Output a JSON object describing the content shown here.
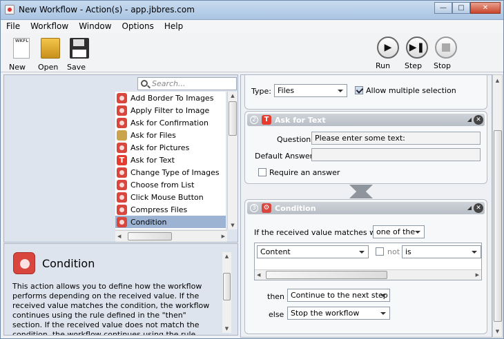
{
  "window": {
    "title": "New Workflow - Action(s) - app.jbbres.com"
  },
  "menu": [
    "File",
    "Workflow",
    "Window",
    "Options",
    "Help"
  ],
  "toolbar": {
    "new_label": "New",
    "open_label": "Open",
    "save_label": "Save",
    "run_label": "Run",
    "step_label": "Step",
    "stop_label": "Stop",
    "new_icon_text": "WKFL"
  },
  "search": {
    "placeholder": "Search..."
  },
  "actions": [
    "Add Border To Images",
    "Apply Filter to Image",
    "Ask for Confirmation",
    "Ask for Files",
    "Ask for Pictures",
    "Ask for Text",
    "Change Type of Images",
    "Choose from List",
    "Click Mouse Button",
    "Compress Files",
    "Condition"
  ],
  "selected_action": "Condition",
  "description": {
    "title": "Condition",
    "text": "This action allows you to define how the workflow performs depending on the received value. If the received value matches the condition, the workflow continues using the rule defined in the \"then\" section. If the received value does not match the condition, the workflow continues using the rule"
  },
  "step1": {
    "type_label": "Type:",
    "type_value": "Files",
    "allow_multiple_label": "Allow multiple selection",
    "allow_multiple": true
  },
  "step2": {
    "number": "2",
    "title": "Ask for Text",
    "question_label": "Question:",
    "question_value": "Please enter some text:",
    "default_label": "Default Answer:",
    "default_value": "",
    "require_label": "Require an answer",
    "require": false
  },
  "step3": {
    "number": "3",
    "title": "Condition",
    "matches_label": "If the received value matches with",
    "matches_value": "one of the",
    "row_field": "Content",
    "not_label": "not",
    "operator": "is",
    "then_label": "then",
    "then_value": "Continue to the next step",
    "else_label": "else",
    "else_value": "Stop the workflow"
  },
  "colors": {
    "title_bar": "#b9d1ea",
    "selection": "#9db3d4",
    "card_header": "#b8bec7",
    "ask_text_icon": "#e53c2f"
  },
  "icons": {
    "step2": "text-t-icon",
    "step3": "condition-gear-icon"
  }
}
